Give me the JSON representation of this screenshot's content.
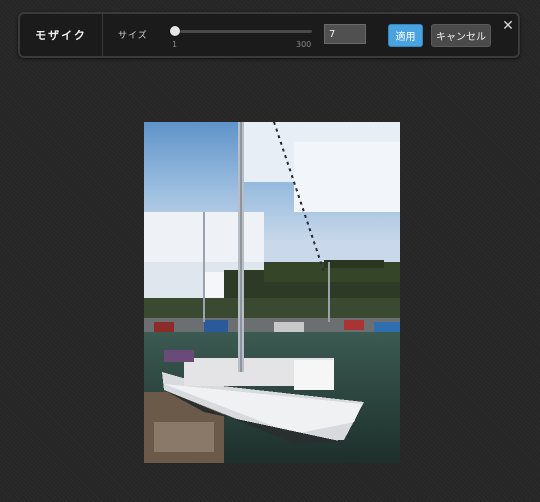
{
  "toolbar": {
    "title": "モザイク",
    "size_label": "サイズ",
    "slider": {
      "min_label": "1",
      "max_label": "300",
      "min": 1,
      "max": 300,
      "value": 7
    },
    "size_value": "7",
    "apply_label": "適用",
    "cancel_label": "キャンセル",
    "close_glyph": "✕"
  },
  "colors": {
    "accent": "#4aa3df",
    "background": "#262626",
    "toolbar_bg": "#1b1b1b"
  },
  "image": {
    "subject": "mosaic-filtered photo of a sailboat in a harbor"
  }
}
